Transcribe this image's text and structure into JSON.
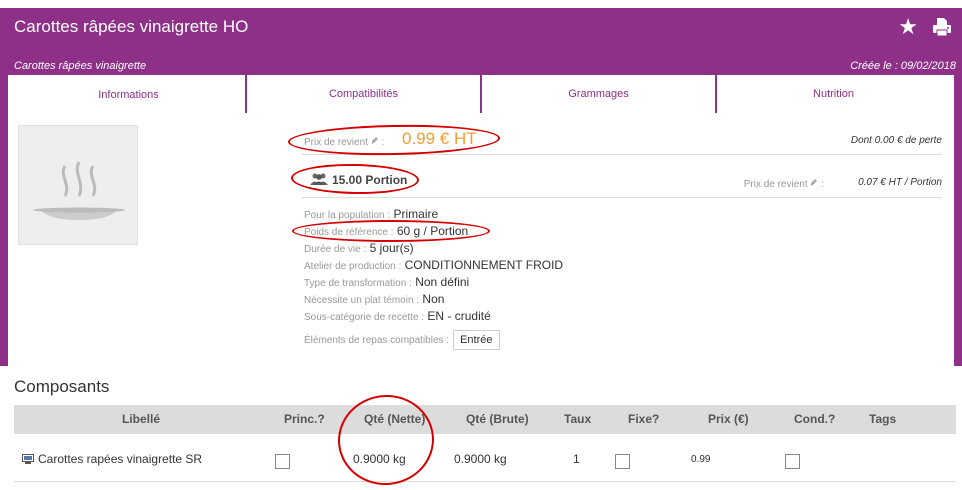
{
  "header": {
    "title": "Carottes râpées vinaigrette HO",
    "subtitle": "Carottes râpées vinaigrette",
    "created": "Créée le : 09/02/2018",
    "star_icon": "★"
  },
  "tabs": [
    "Informations",
    "Compatibilités",
    "Grammages",
    "Nutrition"
  ],
  "cost": {
    "label": "Prix de revient",
    "value": "0.99  € HT",
    "perte": "Dont 0.00 € de perte"
  },
  "portion": {
    "value": "15.00 Portion",
    "pr_label": "Prix de revient",
    "pr_value": "0.07 € HT / Portion"
  },
  "details": [
    {
      "label": "Pour la population :",
      "value": "Primaire"
    },
    {
      "label": "Poids de référence :",
      "value": "60 g / Portion"
    },
    {
      "label": "Durée de vie :",
      "value": "5 jour(s)"
    },
    {
      "label": "Atelier de production :",
      "value": "CONDITIONNEMENT FROID"
    },
    {
      "label": "Type de transformation :",
      "value": "Non défini"
    },
    {
      "label": "Nécessite un plat témoin :",
      "value": "Non"
    },
    {
      "label": "Sous-catégorie de recette :",
      "value": "EN - crudité"
    }
  ],
  "compat": {
    "label": "Éléments de repas compatibles :",
    "chip": "Entrée"
  },
  "section": {
    "title": "Composants"
  },
  "table": {
    "headers": [
      "Libellé",
      "Princ.?",
      "Qté (Nette)",
      "Qté (Brute)",
      "Taux",
      "Fixe?",
      "Prix (€)",
      "Cond.?",
      "Tags"
    ],
    "row": {
      "libelle": "Carottes rapées vinaigrette SR",
      "nette": "0.9000  kg",
      "brute": "0.9000  kg",
      "taux": "1",
      "prix": "0.99"
    }
  },
  "colors": {
    "brand": "#8e3088",
    "cost": "#f0a030",
    "annotation": "#d40000"
  }
}
